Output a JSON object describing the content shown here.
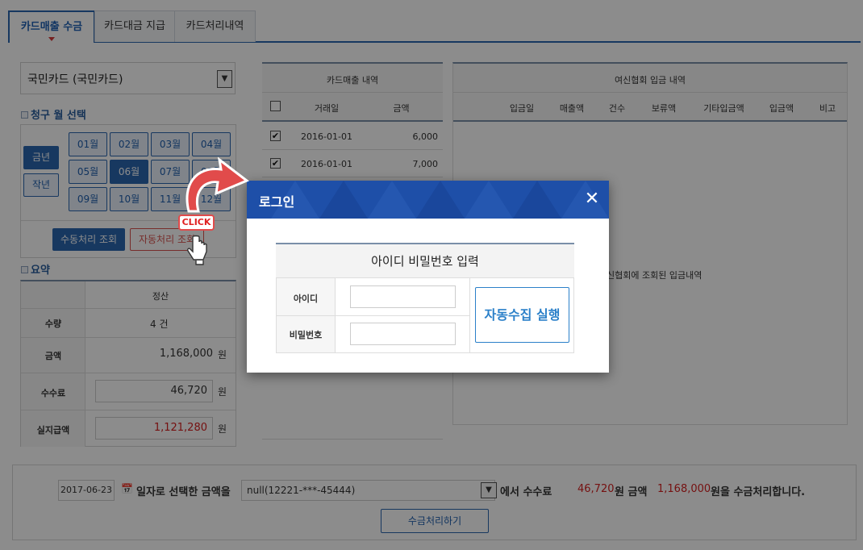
{
  "tabs": [
    "카드매출 수금",
    "카드대금 지급",
    "카드처리내역"
  ],
  "card_select": {
    "value": "국민카드 (국민카드)"
  },
  "month_section": {
    "title": "청구 월 선택",
    "year_buttons": [
      "금년",
      "작년"
    ],
    "months": [
      "01월",
      "02월",
      "03월",
      "04월",
      "05월",
      "06월",
      "07월",
      "08월",
      "09월",
      "10월",
      "11월",
      "12월"
    ],
    "selected_month": "06월",
    "manual_button": "수동처리 조회",
    "auto_button": "자동처리 조회"
  },
  "summary": {
    "title": "요약",
    "col_header": "정산",
    "rows": {
      "qty_label": "수량",
      "qty_value": "4 건",
      "amount_label": "금액",
      "amount_value": "1,168,000",
      "amount_unit": "원",
      "fee_label": "수수료",
      "fee_value": "46,720",
      "fee_unit": "원",
      "net_label": "실지급액",
      "net_value": "1,121,280",
      "net_unit": "원"
    }
  },
  "sales_table": {
    "title": "카드매출 내역",
    "columns": [
      "거래일",
      "금액"
    ],
    "rows": [
      {
        "date": "2016-01-01",
        "amount": "6,000"
      },
      {
        "date": "2016-01-01",
        "amount": "7,000"
      }
    ]
  },
  "deposit_table": {
    "title": "여신협회 입금 내역",
    "columns": [
      "입금일",
      "매출액",
      "건수",
      "보류액",
      "기타입금액",
      "입금액",
      "비고"
    ],
    "empty_text": "신협회에 조회된 입금내역"
  },
  "bottom": {
    "date": "2017-06-23",
    "text1": "일자로 선택한 금액을",
    "account": "null(12221-***-45444)",
    "text2": "에서 수수료",
    "fee": "46,720",
    "text3": "원 금액",
    "amount": "1,168,000",
    "text4": "원을 수금처리합니다.",
    "button": "수금처리하기"
  },
  "modal": {
    "title": "로그인",
    "heading": "아이디 비밀번호 입력",
    "id_label": "아이디",
    "pw_label": "비밀번호",
    "run_button": "자동수집 실행",
    "close_icon": "close-icon"
  },
  "callout": {
    "text": "CLICK"
  },
  "colors": {
    "brand": "#1e4fa8",
    "accent": "#2b66b0",
    "red": "#d61f1f"
  }
}
